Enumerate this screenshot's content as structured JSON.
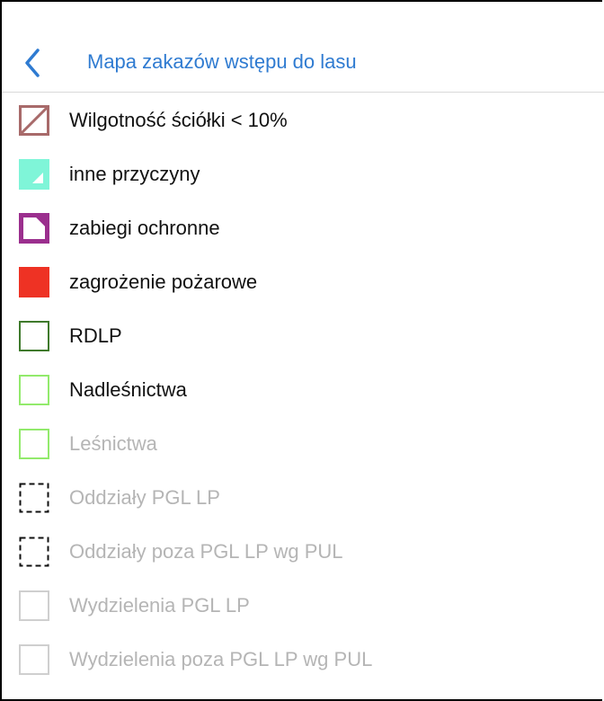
{
  "header": {
    "title": "Mapa zakazów wstępu do lasu",
    "back_icon": "chevron-left-icon",
    "accent_color": "#2f7bd1"
  },
  "legend": {
    "items": [
      {
        "label": "Wilgotność ściółki < 10%",
        "swatch": "diagonal-brown",
        "enabled": true
      },
      {
        "label": "inne przyczyny",
        "swatch": "cyan-corner",
        "enabled": true
      },
      {
        "label": "zabiegi ochronne",
        "swatch": "purple-corner",
        "enabled": true
      },
      {
        "label": "zagrożenie pożarowe",
        "swatch": "red-fill",
        "enabled": true
      },
      {
        "label": "RDLP",
        "swatch": "dark-green-outline",
        "enabled": true
      },
      {
        "label": "Nadleśnictwa",
        "swatch": "light-green-outline",
        "enabled": true
      },
      {
        "label": "Leśnictwa",
        "swatch": "light-green-outline",
        "enabled": false
      },
      {
        "label": "Oddziały PGL LP",
        "swatch": "black-dashed-outline",
        "enabled": false
      },
      {
        "label": "Oddziały poza PGL LP wg PUL",
        "swatch": "black-dashed-outline",
        "enabled": false
      },
      {
        "label": "Wydzielenia PGL LP",
        "swatch": "grey-outline",
        "enabled": false
      },
      {
        "label": "Wydzielenia poza PGL LP wg PUL",
        "swatch": "grey-outline",
        "enabled": false
      }
    ]
  },
  "colors": {
    "brown": "#a86a6a",
    "cyan": "#7ff5d8",
    "purple": "#9b2f8e",
    "red": "#ee3224",
    "dark_green": "#3f7a2c",
    "light_green": "#92ea6c",
    "grey": "#cfcfcf",
    "inactive_text": "#b5b5b5"
  }
}
